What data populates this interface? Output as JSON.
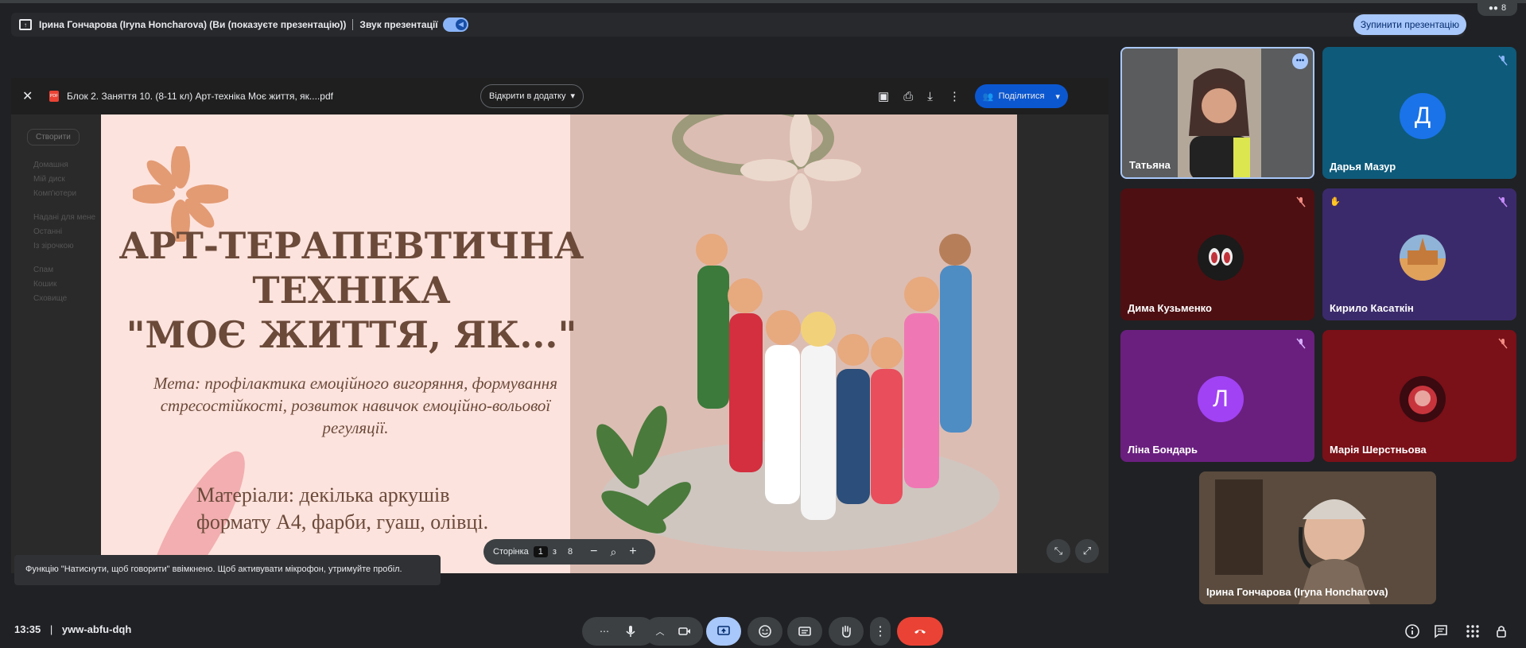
{
  "presenting_bar": {
    "presenter_text": "Ірина Гончарова (Iryna Honcharova) (Ви (показуєте презентацію))",
    "sound_label": "Звук презентації",
    "stop_button": "Зупинити презентацію"
  },
  "people_count": "8",
  "viewer": {
    "file_name": "Блок 2. Заняття 10. (8-11 кл) Арт-техніка Моє життя, як....pdf",
    "open_in_app": "Відкрити в додатку",
    "share_label": "Поділитися",
    "bg_menu": [
      "Створити",
      "Домашня",
      "Мій диск",
      "Комп'ютери",
      "Надані для мене",
      "Останні",
      "Із зірочкою",
      "Спам",
      "Кошик",
      "Сховище"
    ]
  },
  "slide": {
    "title_line1": "АРТ-ТЕРАПЕВТИЧНА",
    "title_line2": "ТЕХНІКА",
    "title_line3": "\"МОЄ ЖИТТЯ, ЯК...\"",
    "goal": "Мета: профілактика емоційного вигоряння, формування стресостійкості, розвиток навичок емоційно-вольової регуляції.",
    "materials_line1": "Матеріали: декілька аркушів",
    "materials_line2": "формату А4, фарби, гуаш, олівці."
  },
  "page_control": {
    "label": "Сторінка",
    "current": "1",
    "of": "з",
    "total": "8"
  },
  "participants": [
    {
      "name": "Татьяна",
      "avatar_letter": "",
      "muted": false
    },
    {
      "name": "Дарья Мазур",
      "avatar_letter": "Д",
      "muted": true
    },
    {
      "name": "Дима Кузьменко",
      "avatar_letter": "",
      "muted": true
    },
    {
      "name": "Кирило Касаткін",
      "avatar_letter": "",
      "muted": true
    },
    {
      "name": "Ліна Бондарь",
      "avatar_letter": "Л",
      "muted": true
    },
    {
      "name": "Марія Шерстньова",
      "avatar_letter": "",
      "muted": true
    },
    {
      "name": "Ірина Гончарова (Iryna Honcharova)",
      "avatar_letter": "",
      "muted": false
    }
  ],
  "toast": "Функцію \"Натиснути, щоб говорити\" ввімкнено. Щоб активувати мікрофон, утримуйте пробіл.",
  "footer": {
    "time": "13:35",
    "separator": "|",
    "meeting_code": "yww-abfu-dqh"
  },
  "colors": {
    "stop_button": "#a8c7fa",
    "leave_button": "#ea4335",
    "present_active": "#a8c7fa"
  }
}
